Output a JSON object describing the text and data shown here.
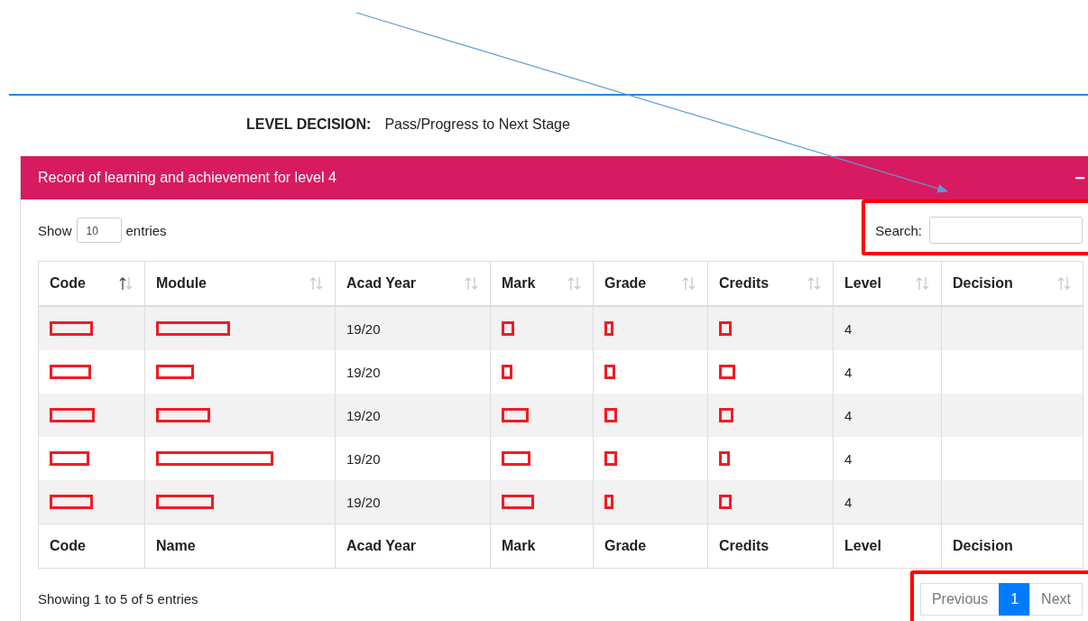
{
  "level_decision": {
    "label": "LEVEL DECISION:",
    "value": "Pass/Progress to Next Stage"
  },
  "panel": {
    "title": "Record of learning and achievement for level 4",
    "collapse_icon": "−"
  },
  "length_control": {
    "before": "Show",
    "value": "10",
    "after": "entries"
  },
  "search": {
    "label": "Search:"
  },
  "table": {
    "columns": [
      {
        "label": "Code",
        "sorted": true
      },
      {
        "label": "Module",
        "sorted": false
      },
      {
        "label": "Acad Year",
        "sorted": false
      },
      {
        "label": "Mark",
        "sorted": false
      },
      {
        "label": "Grade",
        "sorted": false
      },
      {
        "label": "Credits",
        "sorted": false
      },
      {
        "label": "Level",
        "sorted": false
      },
      {
        "label": "Decision",
        "sorted": false
      }
    ],
    "rows": [
      {
        "cells": [
          {
            "kind": "redacted"
          },
          {
            "kind": "redacted"
          },
          {
            "kind": "text",
            "text": "19/20"
          },
          {
            "kind": "redacted"
          },
          {
            "kind": "redacted"
          },
          {
            "kind": "redacted"
          },
          {
            "kind": "text",
            "text": "4"
          },
          {
            "kind": "empty"
          }
        ]
      },
      {
        "cells": [
          {
            "kind": "redacted"
          },
          {
            "kind": "redacted"
          },
          {
            "kind": "text",
            "text": "19/20"
          },
          {
            "kind": "redacted"
          },
          {
            "kind": "redacted"
          },
          {
            "kind": "redacted"
          },
          {
            "kind": "text",
            "text": "4"
          },
          {
            "kind": "empty"
          }
        ]
      },
      {
        "cells": [
          {
            "kind": "redacted"
          },
          {
            "kind": "redacted"
          },
          {
            "kind": "text",
            "text": "19/20"
          },
          {
            "kind": "redacted"
          },
          {
            "kind": "redacted"
          },
          {
            "kind": "redacted"
          },
          {
            "kind": "text",
            "text": "4"
          },
          {
            "kind": "empty"
          }
        ]
      },
      {
        "cells": [
          {
            "kind": "redacted"
          },
          {
            "kind": "redacted"
          },
          {
            "kind": "text",
            "text": "19/20"
          },
          {
            "kind": "redacted"
          },
          {
            "kind": "redacted"
          },
          {
            "kind": "redacted"
          },
          {
            "kind": "text",
            "text": "4"
          },
          {
            "kind": "empty"
          }
        ]
      },
      {
        "cells": [
          {
            "kind": "redacted"
          },
          {
            "kind": "redacted"
          },
          {
            "kind": "text",
            "text": "19/20"
          },
          {
            "kind": "redacted"
          },
          {
            "kind": "redacted"
          },
          {
            "kind": "redacted"
          },
          {
            "kind": "text",
            "text": "4"
          },
          {
            "kind": "empty"
          }
        ]
      }
    ],
    "footer": [
      "Code",
      "Name",
      "Acad Year",
      "Mark",
      "Grade",
      "Credits",
      "Level",
      "Decision"
    ]
  },
  "info": "Showing 1 to 5 of 5 entries",
  "pagination": [
    {
      "label": "Previous",
      "selected": false
    },
    {
      "label": "1",
      "selected": true
    },
    {
      "label": "Next",
      "selected": false
    }
  ]
}
